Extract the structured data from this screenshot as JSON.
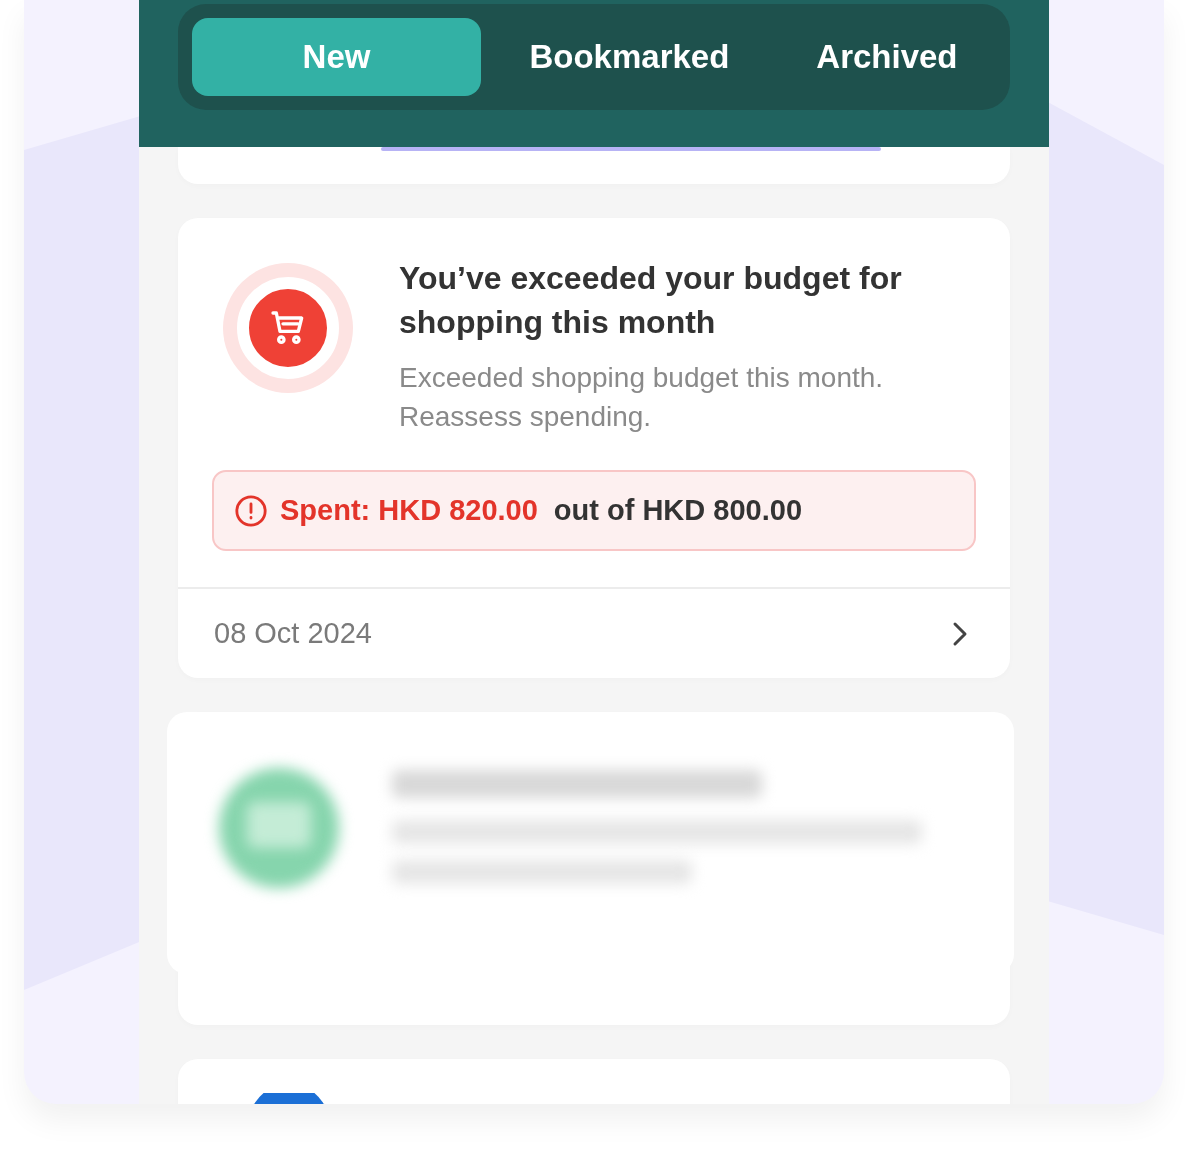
{
  "tabs": [
    {
      "label": "New",
      "selected": true
    },
    {
      "label": "Bookmarked",
      "selected": false
    },
    {
      "label": "Archived",
      "selected": false
    }
  ],
  "notifications": [
    {
      "kind": "partial"
    },
    {
      "kind": "alert",
      "title": "You’ve exceeded your budget for shopping this month",
      "description": "Exceeded shopping budget this month. Reassess spending.",
      "spent": "Spent: HKD 820.00",
      "limit": "out of HKD 800.00",
      "date": "08 Oct 2024"
    },
    {
      "kind": "blurred"
    },
    {
      "kind": "partial-bottom"
    }
  ]
}
